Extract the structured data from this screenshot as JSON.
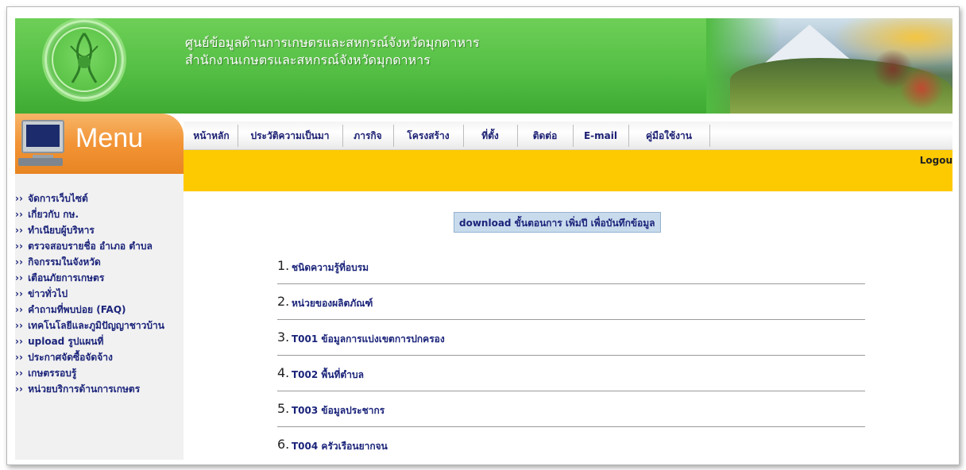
{
  "header": {
    "title_line1": "ศูนย์ข้อมูลด้านการเกษตรและสหกรณ์จังหวัดมุกดาหาร",
    "title_line2": "สำนักงานเกษตรและสหกรณ์จังหวัดมุกดาหาร",
    "colors": {
      "header_green": "#54bf44",
      "menu_orange": "#f29436",
      "yellow_bar": "#fdc900",
      "link_blue": "#1b247a"
    }
  },
  "menu_logo": {
    "label": "Menu",
    "icon": "computer-monitor-icon"
  },
  "nav": {
    "items": [
      {
        "label": "หน้าหลัก"
      },
      {
        "label": "ประวัติความเป็นมา"
      },
      {
        "label": "ภารกิจ"
      },
      {
        "label": "โครงสร้าง"
      },
      {
        "label": "ที่ตั้ง"
      },
      {
        "label": "ติดต่อ"
      },
      {
        "label": "E-mail"
      },
      {
        "label": "คู่มือใช้งาน"
      }
    ]
  },
  "logout_label": "Logou",
  "sidebar": {
    "arrow": "››",
    "items": [
      {
        "label": "จัดการเว็บไซต์"
      },
      {
        "label": "เกี่ยวกับ กษ."
      },
      {
        "label": "ทำเนียบผู้บริหาร"
      },
      {
        "label": "ตรวจสอบรายชื่อ อำเภอ ตำบล"
      },
      {
        "label": "กิจกรรมในจังหวัด"
      },
      {
        "label": "เตือนภัยการเกษตร"
      },
      {
        "label": "ข่าวทั่วไป"
      },
      {
        "label": "คำถามที่พบบ่อย (FAQ)"
      },
      {
        "label": "เทคโนโลยีและภูมิปัญญาชาวบ้าน"
      },
      {
        "label": "upload รูปแผนที่"
      },
      {
        "label": "ประกาศจัดซื้อจัดจ้าง"
      },
      {
        "label": "เกษตรรอบรู้"
      },
      {
        "label": "หน่วยบริการด้านการเกษตร"
      }
    ]
  },
  "main": {
    "download_label": "download ขั้นตอนการ เพิ่มปี เพื่อบันทึกข้อมูล",
    "list": [
      {
        "num": "1.",
        "text": "ชนิดความรู้ที่อบรม"
      },
      {
        "num": "2.",
        "text": "หน่วยของผลิตภัณฑ์"
      },
      {
        "num": "3.",
        "text": "T001 ข้อมูลการแบ่งเขตการปกครอง"
      },
      {
        "num": "4.",
        "text": "T002 พื้นที่ตำบล"
      },
      {
        "num": "5.",
        "text": "T003 ข้อมูลประชากร"
      },
      {
        "num": "6.",
        "text": "T004 ครัวเรือนยากจน"
      }
    ]
  }
}
